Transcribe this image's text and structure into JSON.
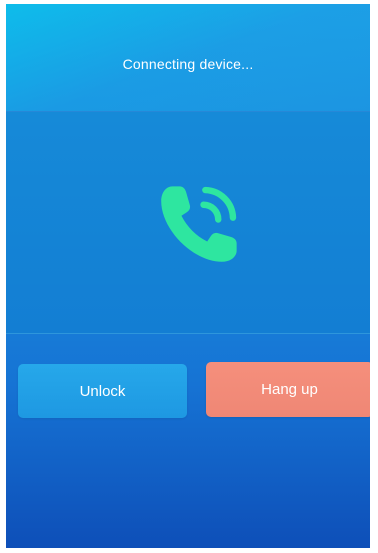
{
  "status": {
    "text": "Connecting device..."
  },
  "call": {
    "icon": "phone-call-icon",
    "icon_color": "#2ee6a0"
  },
  "actions": {
    "unlock_label": "Unlock",
    "hangup_label": "Hang up"
  },
  "colors": {
    "background": "#1a8fdf",
    "unlock_button": "#23a2e8",
    "hangup_button": "#f28a77"
  }
}
